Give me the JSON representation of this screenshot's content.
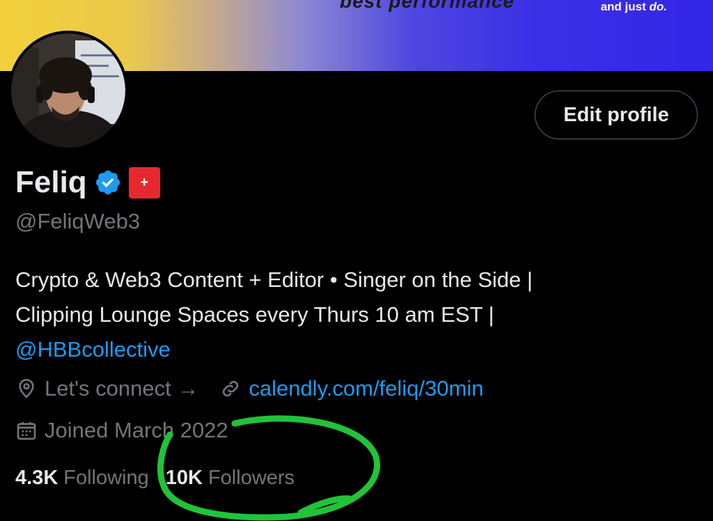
{
  "banner": {
    "headline": "best performance",
    "tagline_prefix": "and just ",
    "tagline_emphasis": "do."
  },
  "profile": {
    "name": "Feliq",
    "handle": "@FeliqWeb3",
    "edit_button_label": "Edit profile",
    "flag_symbol": "+",
    "bio_line1": "Crypto & Web3 Content + Editor • Singer on the Side |",
    "bio_line2": "Clipping Lounge Spaces every Thurs 10 am EST |",
    "bio_mention": "@HBBcollective",
    "location": "Let's connect →",
    "website": "calendly.com/feliq/30min",
    "joined": "Joined March 2022",
    "following_count": "4.3K",
    "following_label": "Following",
    "followers_count": "10K",
    "followers_label": "Followers"
  },
  "icons": {
    "verified": "verified-badge-icon",
    "location": "location-pin-icon",
    "link": "link-icon",
    "calendar": "calendar-icon"
  },
  "colors": {
    "background": "#000000",
    "text": "#e7e9ea",
    "muted": "#71767b",
    "link": "#1d9bf0",
    "verified": "#1d9bf0",
    "flag": "#e8282f",
    "annotation": "#22c23a"
  }
}
